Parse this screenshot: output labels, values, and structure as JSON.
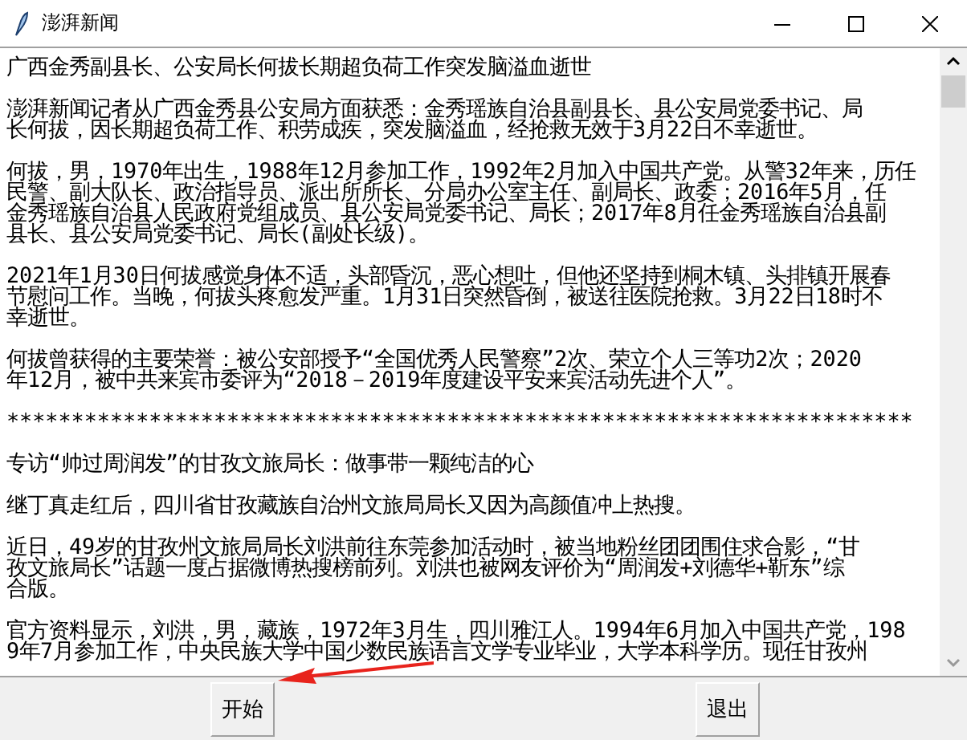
{
  "window": {
    "title": "澎湃新闻"
  },
  "article": {
    "paragraphs": [
      {
        "lines": [
          "广西金秀副县长、公安局长何拔长期超负荷工作突发脑溢血逝世"
        ]
      },
      {
        "lines": [
          "澎湃新闻记者从广西金秀县公安局方面获悉：金秀瑶族自治县副县长、县公安局党委书记、局",
          "长何拔，因长期超负荷工作、积劳成疾，突发脑溢血，经抢救无效于3月22日不幸逝世。"
        ]
      },
      {
        "lines": [
          "何拔，男，1970年出生，1988年12月参加工作，1992年2月加入中国共产党。从警32年来，历任",
          "民警、副大队长、政治指导员、派出所所长、分局办公室主任、副局长、政委；2016年5月，任",
          "金秀瑶族自治县人民政府党组成员、县公安局党委书记、局长；2017年8月任金秀瑶族自治县副",
          "县长、县公安局党委书记、局长(副处长级)。"
        ]
      },
      {
        "lines": [
          "2021年1月30日何拔感觉身体不适，头部昏沉，恶心想吐，但他还坚持到桐木镇、头排镇开展春",
          "节慰问工作。当晚，何拔头疼愈发严重。1月31日突然昏倒，被送往医院抢救。3月22日18时不",
          "幸逝世。"
        ]
      },
      {
        "lines": [
          "何拔曾获得的主要荣誉：被公安部授予“全国优秀人民警察”2次、荣立个人三等功2次；2020",
          "年12月，被中共来宾市委评为“2018－2019年度建设平安来宾活动先进个人”。"
        ]
      },
      {
        "lines": [
          "**********************************************************************"
        ]
      },
      {
        "lines": [
          "专访“帅过周润发”的甘孜文旅局长：做事带一颗纯洁的心"
        ]
      },
      {
        "lines": [
          "继丁真走红后，四川省甘孜藏族自治州文旅局局长又因为高颜值冲上热搜。"
        ]
      },
      {
        "lines": [
          "近日，49岁的甘孜州文旅局局长刘洪前往东莞参加活动时，被当地粉丝团团围住求合影，“甘",
          "孜文旅局长”话题一度占据微博热搜榜前列。刘洪也被网友评价为“周润发+刘德华+靳东”综",
          "合版。"
        ]
      },
      {
        "lines": [
          "官方资料显示，刘洪，男，藏族，1972年3月生，四川雅江人。1994年6月加入中国共产党，198",
          "9年7月参加工作，中央民族大学中国少数民族语言文学专业毕业，大学本科学历。现任甘孜州"
        ]
      }
    ]
  },
  "buttons": [
    {
      "label": "开始"
    },
    {
      "label": "退出"
    }
  ]
}
